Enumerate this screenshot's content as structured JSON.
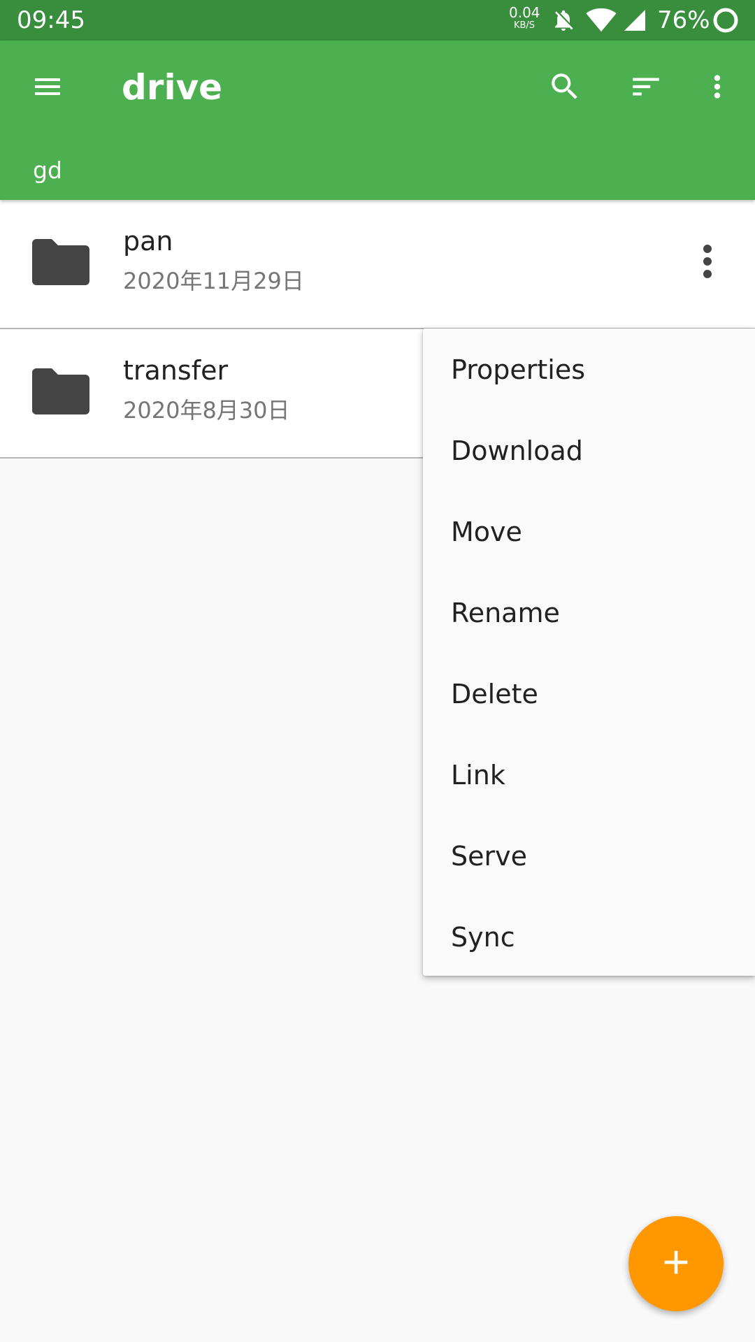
{
  "status_bar": {
    "time": "09:45",
    "net_speed_value": "0.04",
    "net_speed_unit": "KB/S",
    "battery_percent": "76%",
    "icons": [
      "notifications-off-icon",
      "wifi-icon",
      "cell-signal-icon",
      "battery-ring-icon"
    ]
  },
  "app_bar": {
    "title": "drive",
    "breadcrumb": "gd",
    "icons": [
      "menu-icon",
      "search-icon",
      "sort-icon",
      "more-vert-icon"
    ]
  },
  "files": [
    {
      "name": "pan",
      "date": "2020年11月29日",
      "icon": "folder-icon",
      "has_menu_button": true
    },
    {
      "name": "transfer",
      "date": "2020年8月30日",
      "icon": "folder-icon"
    }
  ],
  "context_menu": {
    "items": [
      "Properties",
      "Download",
      "Move",
      "Rename",
      "Delete",
      "Link",
      "Serve",
      "Sync"
    ]
  },
  "fab": {
    "icon": "add-icon"
  },
  "colors": {
    "status_bar": "#388e3c",
    "app_bar": "#4caf50",
    "fab": "#ff9800",
    "background": "#f9f9f9",
    "icon_dark": "#444444"
  }
}
